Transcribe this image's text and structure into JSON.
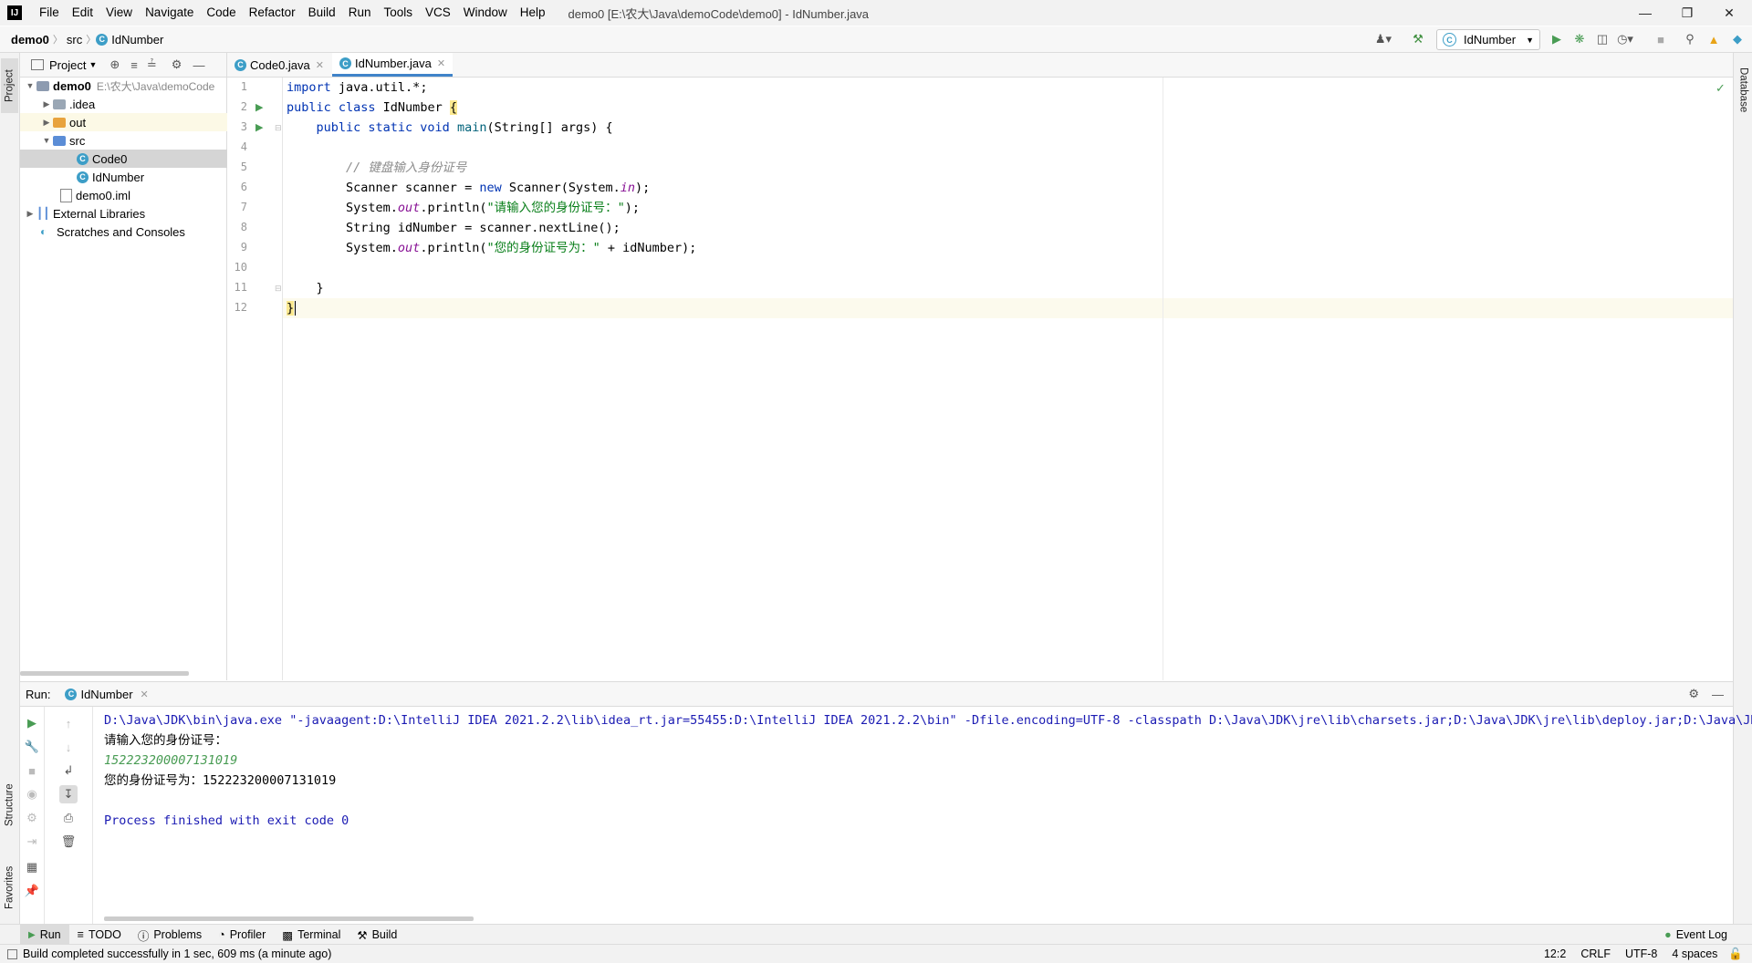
{
  "menu": {
    "items": [
      "File",
      "Edit",
      "View",
      "Navigate",
      "Code",
      "Refactor",
      "Build",
      "Run",
      "Tools",
      "VCS",
      "Window",
      "Help"
    ],
    "window_title": "demo0 [E:\\农大\\Java\\demoCode\\demo0] - IdNumber.java"
  },
  "breadcrumb": {
    "project": "demo0",
    "folder": "src",
    "file": "IdNumber"
  },
  "toolbar": {
    "run_config": "IdNumber"
  },
  "project_panel": {
    "title": "Project",
    "root_name": "demo0",
    "root_path": "E:\\农大\\Java\\demoCode",
    "items": {
      "idea": ".idea",
      "out": "out",
      "src": "src",
      "code0": "Code0",
      "idnumber": "IdNumber",
      "iml": "demo0.iml",
      "ext_libs": "External Libraries",
      "scratches": "Scratches and Consoles"
    }
  },
  "stripe": {
    "project": "Project",
    "structure": "Structure",
    "favorites": "Favorites",
    "database": "Database"
  },
  "editor": {
    "tabs": [
      "Code0.java",
      "IdNumber.java"
    ],
    "active_tab": "IdNumber.java",
    "line_numbers": [
      "1",
      "2",
      "3",
      "4",
      "5",
      "6",
      "7",
      "8",
      "9",
      "10",
      "11",
      "12"
    ],
    "code": {
      "l1_kw": "import",
      "l1_rest": " java.util.*;",
      "l2_kw": "public class",
      "l2_name": " IdNumber ",
      "l2_brace": "{",
      "l3_kw1": "    public static void ",
      "l3_m": "main",
      "l3_rest": "(String[] args) {",
      "l5_cmt": "        // 键盘输入身份证号",
      "l6_a": "        Scanner scanner = ",
      "l6_kw": "new",
      "l6_b": " Scanner(System.",
      "l6_f": "in",
      "l6_c": ");",
      "l7_a": "        System.",
      "l7_f": "out",
      "l7_b": ".println(",
      "l7_s": "\"请输入您的身份证号：\"",
      "l7_c": ");",
      "l8": "        String idNumber = scanner.nextLine();",
      "l9_a": "        System.",
      "l9_f": "out",
      "l9_b": ".println(",
      "l9_s": "\"您的身份证号为：\"",
      "l9_c": " + idNumber);",
      "l11": "    }",
      "l12": "}"
    }
  },
  "run_panel": {
    "label": "Run:",
    "tab": "IdNumber",
    "console": {
      "cmd": "D:\\Java\\JDK\\bin\\java.exe \"-javaagent:D:\\IntelliJ IDEA 2021.2.2\\lib\\idea_rt.jar=55455:D:\\IntelliJ IDEA 2021.2.2\\bin\" -Dfile.encoding=UTF-8 -classpath D:\\Java\\JDK\\jre\\lib\\charsets.jar;D:\\Java\\JDK\\jre\\lib\\deploy.jar;D:\\Java\\JDK\\j",
      "prompt": "请输入您的身份证号：",
      "input": "152223200007131019",
      "output": "您的身份证号为：152223200007131019",
      "exit": "Process finished with exit code 0"
    }
  },
  "bottom_tools": {
    "run": "Run",
    "todo": "TODO",
    "problems": "Problems",
    "profiler": "Profiler",
    "terminal": "Terminal",
    "build": "Build",
    "event_log": "Event Log"
  },
  "status": {
    "message": "Build completed successfully in 1 sec, 609 ms (a minute ago)",
    "position": "12:2",
    "line_sep": "CRLF",
    "encoding": "UTF-8",
    "indent": "4 spaces"
  },
  "colors": {
    "keyword": "#0033b3",
    "string": "#067d17",
    "comment": "#8c8c8c",
    "field": "#871094",
    "run_green": "#499c54",
    "console_blue": "#1b1bb3"
  }
}
